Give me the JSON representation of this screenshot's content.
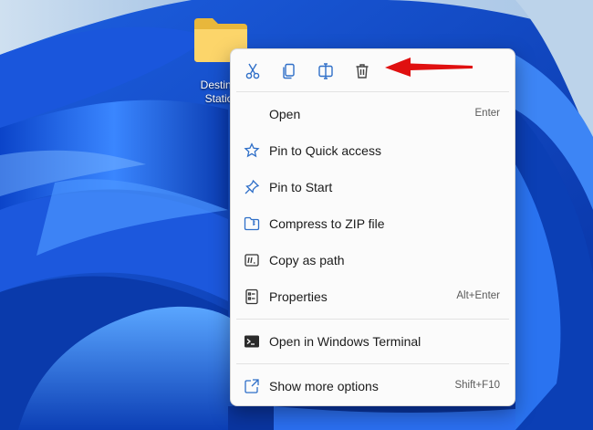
{
  "desktop": {
    "folder_label_line1": "Destina",
    "folder_label_line2": "Statio"
  },
  "quick_actions": [
    {
      "name": "cut",
      "icon": "scissors-icon"
    },
    {
      "name": "copy",
      "icon": "copy-icon"
    },
    {
      "name": "rename",
      "icon": "rename-icon"
    },
    {
      "name": "delete",
      "icon": "trash-icon"
    }
  ],
  "menu": {
    "items": [
      {
        "label": "Open",
        "shortcut": "Enter"
      },
      {
        "label": "Pin to Quick access",
        "shortcut": ""
      },
      {
        "label": "Pin to Start",
        "shortcut": ""
      },
      {
        "label": "Compress to ZIP file",
        "shortcut": ""
      },
      {
        "label": "Copy as path",
        "shortcut": ""
      },
      {
        "label": "Properties",
        "shortcut": "Alt+Enter"
      },
      {
        "label": "Open in Windows Terminal",
        "shortcut": ""
      },
      {
        "label": "Show more options",
        "shortcut": "Shift+F10"
      }
    ]
  },
  "colors": {
    "accent": "#2f6fc8",
    "arrow": "#e01010",
    "wallpaper": "#0b3fb8"
  }
}
